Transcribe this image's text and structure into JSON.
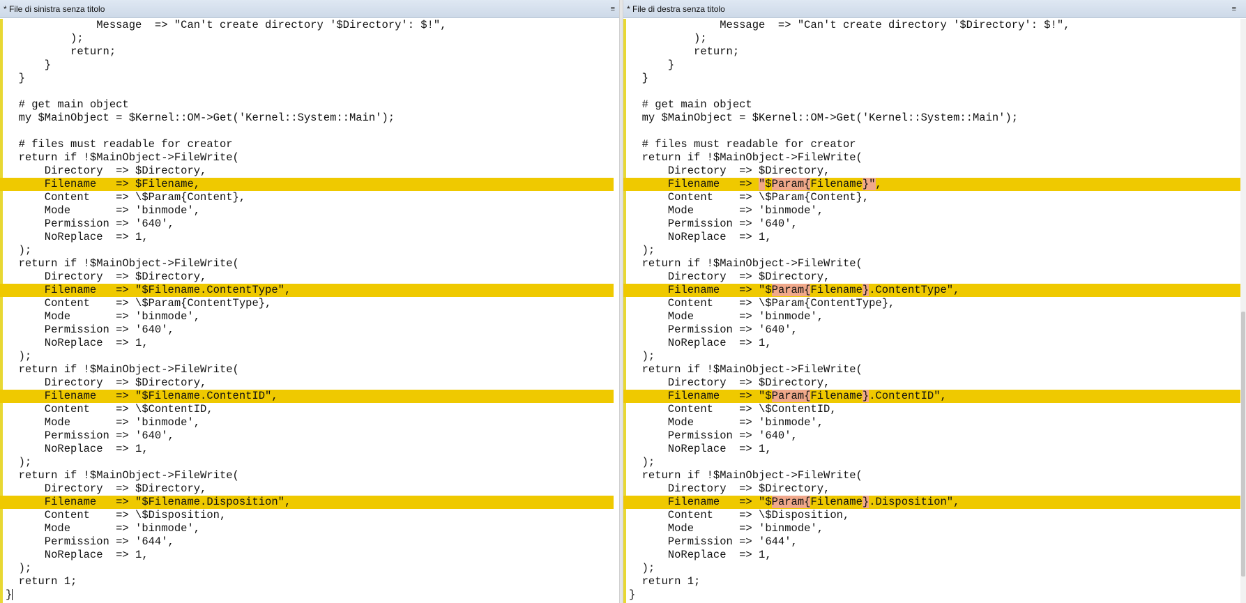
{
  "left": {
    "title": "* File di sinistra senza titolo",
    "menu_glyph": "≡",
    "lines": [
      {
        "text": "              Message  => \"Can't create directory '$Directory': $!\","
      },
      {
        "text": "          );"
      },
      {
        "text": "          return;"
      },
      {
        "text": "      }"
      },
      {
        "text": "  }"
      },
      {
        "text": ""
      },
      {
        "text": "  # get main object"
      },
      {
        "text": "  my $MainObject = $Kernel::OM->Get('Kernel::System::Main');"
      },
      {
        "text": ""
      },
      {
        "text": "  # files must readable for creator"
      },
      {
        "text": "  return if !$MainObject->FileWrite("
      },
      {
        "text": "      Directory  => $Directory,"
      },
      {
        "text": "      Filename   => $Filename,",
        "changed": true
      },
      {
        "text": "      Content    => \\$Param{Content},"
      },
      {
        "text": "      Mode       => 'binmode',"
      },
      {
        "text": "      Permission => '640',"
      },
      {
        "text": "      NoReplace  => 1,"
      },
      {
        "text": "  );"
      },
      {
        "text": "  return if !$MainObject->FileWrite("
      },
      {
        "text": "      Directory  => $Directory,"
      },
      {
        "text": "      Filename   => \"$Filename.ContentType\",",
        "changed": true
      },
      {
        "text": "      Content    => \\$Param{ContentType},"
      },
      {
        "text": "      Mode       => 'binmode',"
      },
      {
        "text": "      Permission => '640',"
      },
      {
        "text": "      NoReplace  => 1,"
      },
      {
        "text": "  );"
      },
      {
        "text": "  return if !$MainObject->FileWrite("
      },
      {
        "text": "      Directory  => $Directory,"
      },
      {
        "text": "      Filename   => \"$Filename.ContentID\",",
        "changed": true
      },
      {
        "text": "      Content    => \\$ContentID,"
      },
      {
        "text": "      Mode       => 'binmode',"
      },
      {
        "text": "      Permission => '640',"
      },
      {
        "text": "      NoReplace  => 1,"
      },
      {
        "text": "  );"
      },
      {
        "text": "  return if !$MainObject->FileWrite("
      },
      {
        "text": "      Directory  => $Directory,"
      },
      {
        "text": "      Filename   => \"$Filename.Disposition\",",
        "changed": true
      },
      {
        "text": "      Content    => \\$Disposition,"
      },
      {
        "text": "      Mode       => 'binmode',"
      },
      {
        "text": "      Permission => '644',"
      },
      {
        "text": "      NoReplace  => 1,"
      },
      {
        "text": "  );"
      },
      {
        "text": "  return 1;"
      },
      {
        "text": "}",
        "caret": true
      }
    ]
  },
  "right": {
    "title": "* File di destra senza titolo",
    "menu_glyph": "≡",
    "lines": [
      {
        "text": "              Message  => \"Can't create directory '$Directory': $!\","
      },
      {
        "text": "          );"
      },
      {
        "text": "          return;"
      },
      {
        "text": "      }"
      },
      {
        "text": "  }"
      },
      {
        "text": ""
      },
      {
        "text": "  # get main object"
      },
      {
        "text": "  my $MainObject = $Kernel::OM->Get('Kernel::System::Main');"
      },
      {
        "text": ""
      },
      {
        "text": "  # files must readable for creator"
      },
      {
        "text": "  return if !$MainObject->FileWrite("
      },
      {
        "text": "      Directory  => $Directory,"
      },
      {
        "changed": true,
        "segments": [
          {
            "text": "      Filename   => "
          },
          {
            "text": "\"",
            "hl": true
          },
          {
            "text": "$"
          },
          {
            "text": "Param{",
            "hl": true
          },
          {
            "text": "Filename"
          },
          {
            "text": "}\"",
            "hl": true
          },
          {
            "text": ","
          }
        ]
      },
      {
        "text": "      Content    => \\$Param{Content},"
      },
      {
        "text": "      Mode       => 'binmode',"
      },
      {
        "text": "      Permission => '640',"
      },
      {
        "text": "      NoReplace  => 1,"
      },
      {
        "text": "  );"
      },
      {
        "text": "  return if !$MainObject->FileWrite("
      },
      {
        "text": "      Directory  => $Directory,"
      },
      {
        "changed": true,
        "segments": [
          {
            "text": "      Filename   => \"$"
          },
          {
            "text": "Param{",
            "hl": true
          },
          {
            "text": "Filename"
          },
          {
            "text": "}",
            "hl": true
          },
          {
            "text": ".ContentType\","
          }
        ]
      },
      {
        "text": "      Content    => \\$Param{ContentType},"
      },
      {
        "text": "      Mode       => 'binmode',"
      },
      {
        "text": "      Permission => '640',"
      },
      {
        "text": "      NoReplace  => 1,"
      },
      {
        "text": "  );"
      },
      {
        "text": "  return if !$MainObject->FileWrite("
      },
      {
        "text": "      Directory  => $Directory,"
      },
      {
        "changed": true,
        "segments": [
          {
            "text": "      Filename   => \"$"
          },
          {
            "text": "Param{",
            "hl": true
          },
          {
            "text": "Filename"
          },
          {
            "text": "}",
            "hl": true
          },
          {
            "text": ".ContentID\","
          }
        ]
      },
      {
        "text": "      Content    => \\$ContentID,"
      },
      {
        "text": "      Mode       => 'binmode',"
      },
      {
        "text": "      Permission => '640',"
      },
      {
        "text": "      NoReplace  => 1,"
      },
      {
        "text": "  );"
      },
      {
        "text": "  return if !$MainObject->FileWrite("
      },
      {
        "text": "      Directory  => $Directory,"
      },
      {
        "changed": true,
        "segments": [
          {
            "text": "      Filename   => \"$"
          },
          {
            "text": "Param{",
            "hl": true
          },
          {
            "text": "Filename"
          },
          {
            "text": "}",
            "hl": true
          },
          {
            "text": ".Disposition\","
          }
        ]
      },
      {
        "text": "      Content    => \\$Disposition,"
      },
      {
        "text": "      Mode       => 'binmode',"
      },
      {
        "text": "      Permission => '644',"
      },
      {
        "text": "      NoReplace  => 1,"
      },
      {
        "text": "  );"
      },
      {
        "text": "  return 1;"
      },
      {
        "text": "}"
      }
    ]
  },
  "colors": {
    "changed_line": "#efc900",
    "inline_diff": "#f0a88a",
    "gutter": "#e8d833"
  }
}
